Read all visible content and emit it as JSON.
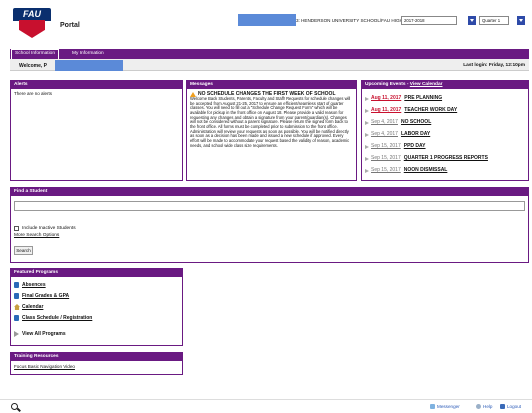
{
  "app": {
    "logo_text": "FAU",
    "title": "Portal"
  },
  "header": {
    "school_text": "3: HENDERSON UNIVERSITY SCHOOL/FAU HIGH SCHOOL",
    "year_select": "2017-2018",
    "term_select": "Quarter 1"
  },
  "nav": {
    "tabs": [
      "School Information",
      "My Information"
    ]
  },
  "welcome": {
    "label": "Welcome, P",
    "last_login": "Last login: Friday, 12:10pm"
  },
  "alerts": {
    "title": "Alerts",
    "body": "There are no alerts"
  },
  "messages": {
    "title": "Messages",
    "headline": "NO SCHEDULE CHANGES THE FIRST WEEK OF SCHOOL",
    "body": "Welcome Back Students, Parents, Faculty and Staff! Requests for schedule changes will be accepted from August 21-25, 2017 to ensure an efficient/seamless start of quarter classes. You will need to fill out a \"Schedule Change Request Form\" which will be available for pickup in the front office on August 18. Please provide a valid reason for requesting any changes and obtain a signature from your parent/guardian(s). Changes will not be considered without a parent signature. Please return the signed form back to the front office. All forms must be completed prior to submission to the front office. Administration will review your requests as soon as possible. You will be notified directly as soon as a decision has been made and issued a new schedule if approved. Every effort will be made to accommodate your request based the validity of reason, academic needs, and school wide class size requirements."
  },
  "events": {
    "title": "Upcoming Events - ",
    "view_calendar": "View Calendar",
    "items": [
      {
        "date": "Aug 11, 2017",
        "name": "PRE PLANNING",
        "style": "red"
      },
      {
        "date": "Aug 11, 2017",
        "name": "TEACHER WORK DAY",
        "style": "red"
      },
      {
        "date": "Sep 4, 2017",
        "name": "NO SCHOOL",
        "style": "gray"
      },
      {
        "date": "Sep 4, 2017",
        "name": "LABOR DAY",
        "style": "gray"
      },
      {
        "date": "Sep 15, 2017",
        "name": "PPD DAY",
        "style": "gray"
      },
      {
        "date": "Sep 15, 2017",
        "name": "QUARTER 1 PROGRESS REPORTS",
        "style": "gray"
      },
      {
        "date": "Sep 15, 2017",
        "name": "NOON DISMISSAL",
        "style": "gray"
      }
    ]
  },
  "find_student": {
    "title": "Find a Student",
    "include_inactive": "Include Inactive Students",
    "more_options": "More Search Options",
    "search_button": "Search"
  },
  "programs": {
    "title": "Featured Programs",
    "items": [
      "Absences",
      "Final Grades & GPA",
      "Calendar",
      "Class Schedule / Registration"
    ],
    "view_all": "View All Programs"
  },
  "training": {
    "title": "Training Resources",
    "link": "Focus Basic Navigation Video"
  },
  "footer": {
    "messenger": "Messenger",
    "help": "Help",
    "logout": "Logout"
  }
}
